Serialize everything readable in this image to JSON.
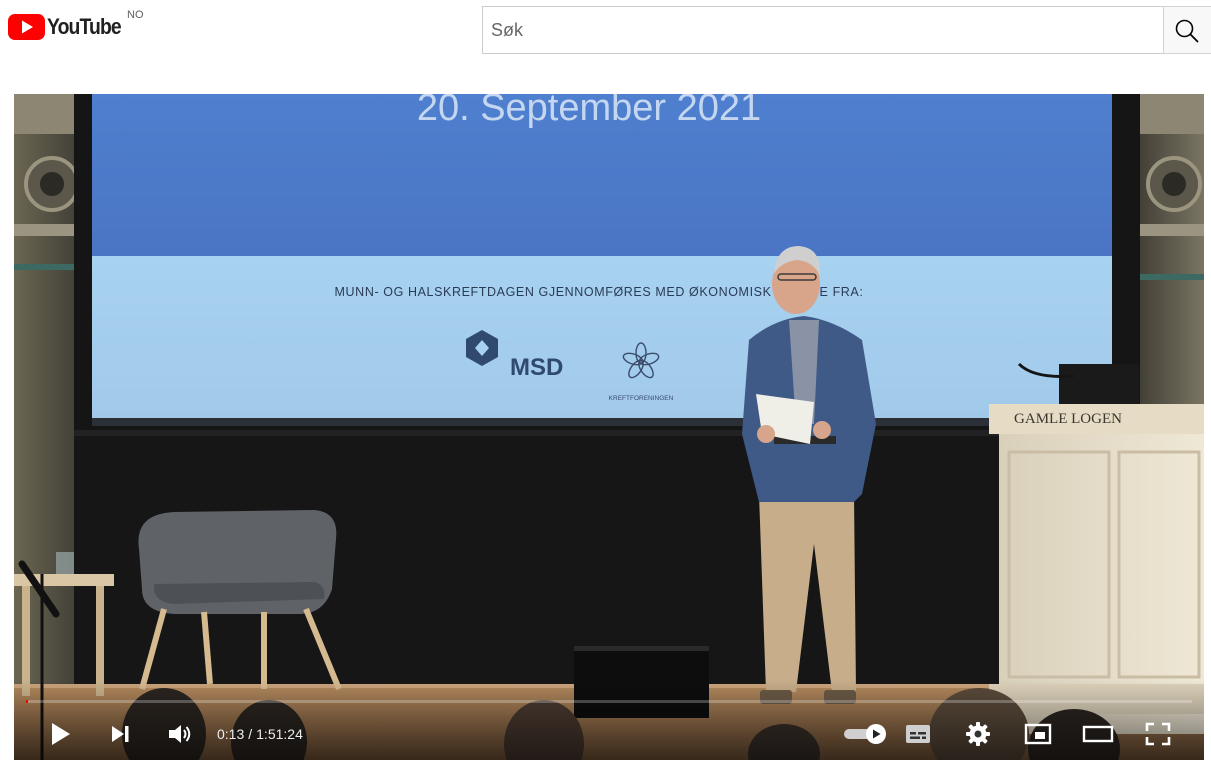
{
  "masthead": {
    "logo_text": "YouTube",
    "country_code": "NO",
    "search_placeholder": "Søk"
  },
  "video_frame": {
    "slide_date": "20. September 2021",
    "slide_sponsor_text": "MUNN- OG HALSKREFTDAGEN GJENNOMFØRES MED ØKONOMISK STØTTE FRA:",
    "sponsor_1": "MSD",
    "sponsor_2": "KREFTFORENINGEN",
    "podium_sign": "GAMLE LOGEN"
  },
  "player": {
    "current_time": "0:13",
    "duration": "1:51:24",
    "progress_fraction": 0.0019
  },
  "icons": {
    "logo": "youtube-logo-icon",
    "search": "search-icon",
    "play": "play-icon",
    "next": "next-icon",
    "volume": "volume-icon",
    "autoplay": "autoplay-toggle-icon",
    "subtitles": "subtitles-icon",
    "settings": "gear-icon",
    "miniplayer": "miniplayer-icon",
    "theater": "theater-mode-icon",
    "fullscreen": "fullscreen-icon"
  },
  "colors": {
    "brand_red": "#ff0000",
    "slide_blue_dark": "#4a78c8",
    "slide_blue_light": "#a9d0ee"
  }
}
